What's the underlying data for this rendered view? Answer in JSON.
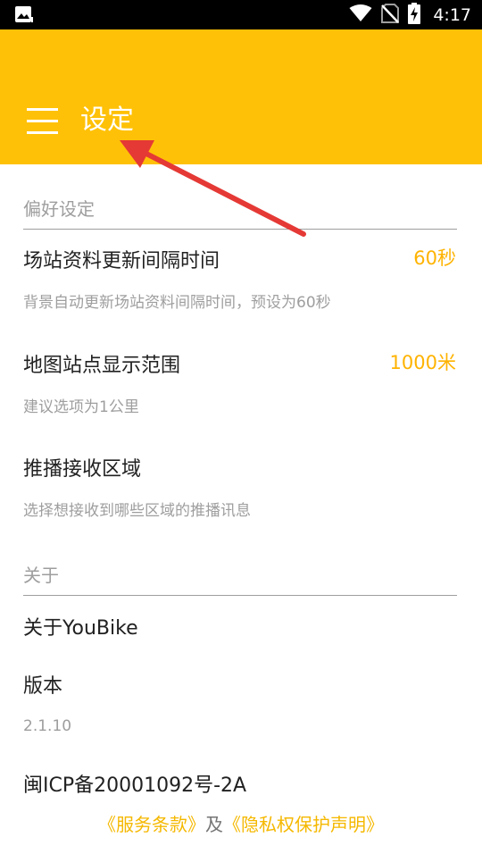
{
  "status_bar": {
    "time": "4:17",
    "icons": [
      "gallery-icon",
      "wifi-icon",
      "no-sim-icon",
      "battery-charging-icon"
    ]
  },
  "app_bar": {
    "menu_icon": "menu-icon",
    "title": "设定",
    "background_color": "#FFC107"
  },
  "preferences": {
    "header": "偏好设定",
    "items": [
      {
        "title": "场站资料更新间隔时间",
        "summary": "背景自动更新场站资料间隔时间，预设为60秒",
        "value": "60秒"
      },
      {
        "title": "地图站点显示范围",
        "summary": "建议选项为1公里",
        "value": "1000米"
      },
      {
        "title": "推播接收区域",
        "summary": "选择想接收到哪些区域的推播讯息"
      }
    ]
  },
  "about": {
    "header": "关于",
    "about_youbike": "关于YouBike",
    "version_title": "版本",
    "version_value": "2.1.10",
    "icp": "闽ICP备20001092号-2A"
  },
  "footer": {
    "terms": "《服务条款》",
    "connector": "及",
    "privacy": "《隐私权保护声明》"
  },
  "annotation": {
    "color": "#E53935"
  }
}
